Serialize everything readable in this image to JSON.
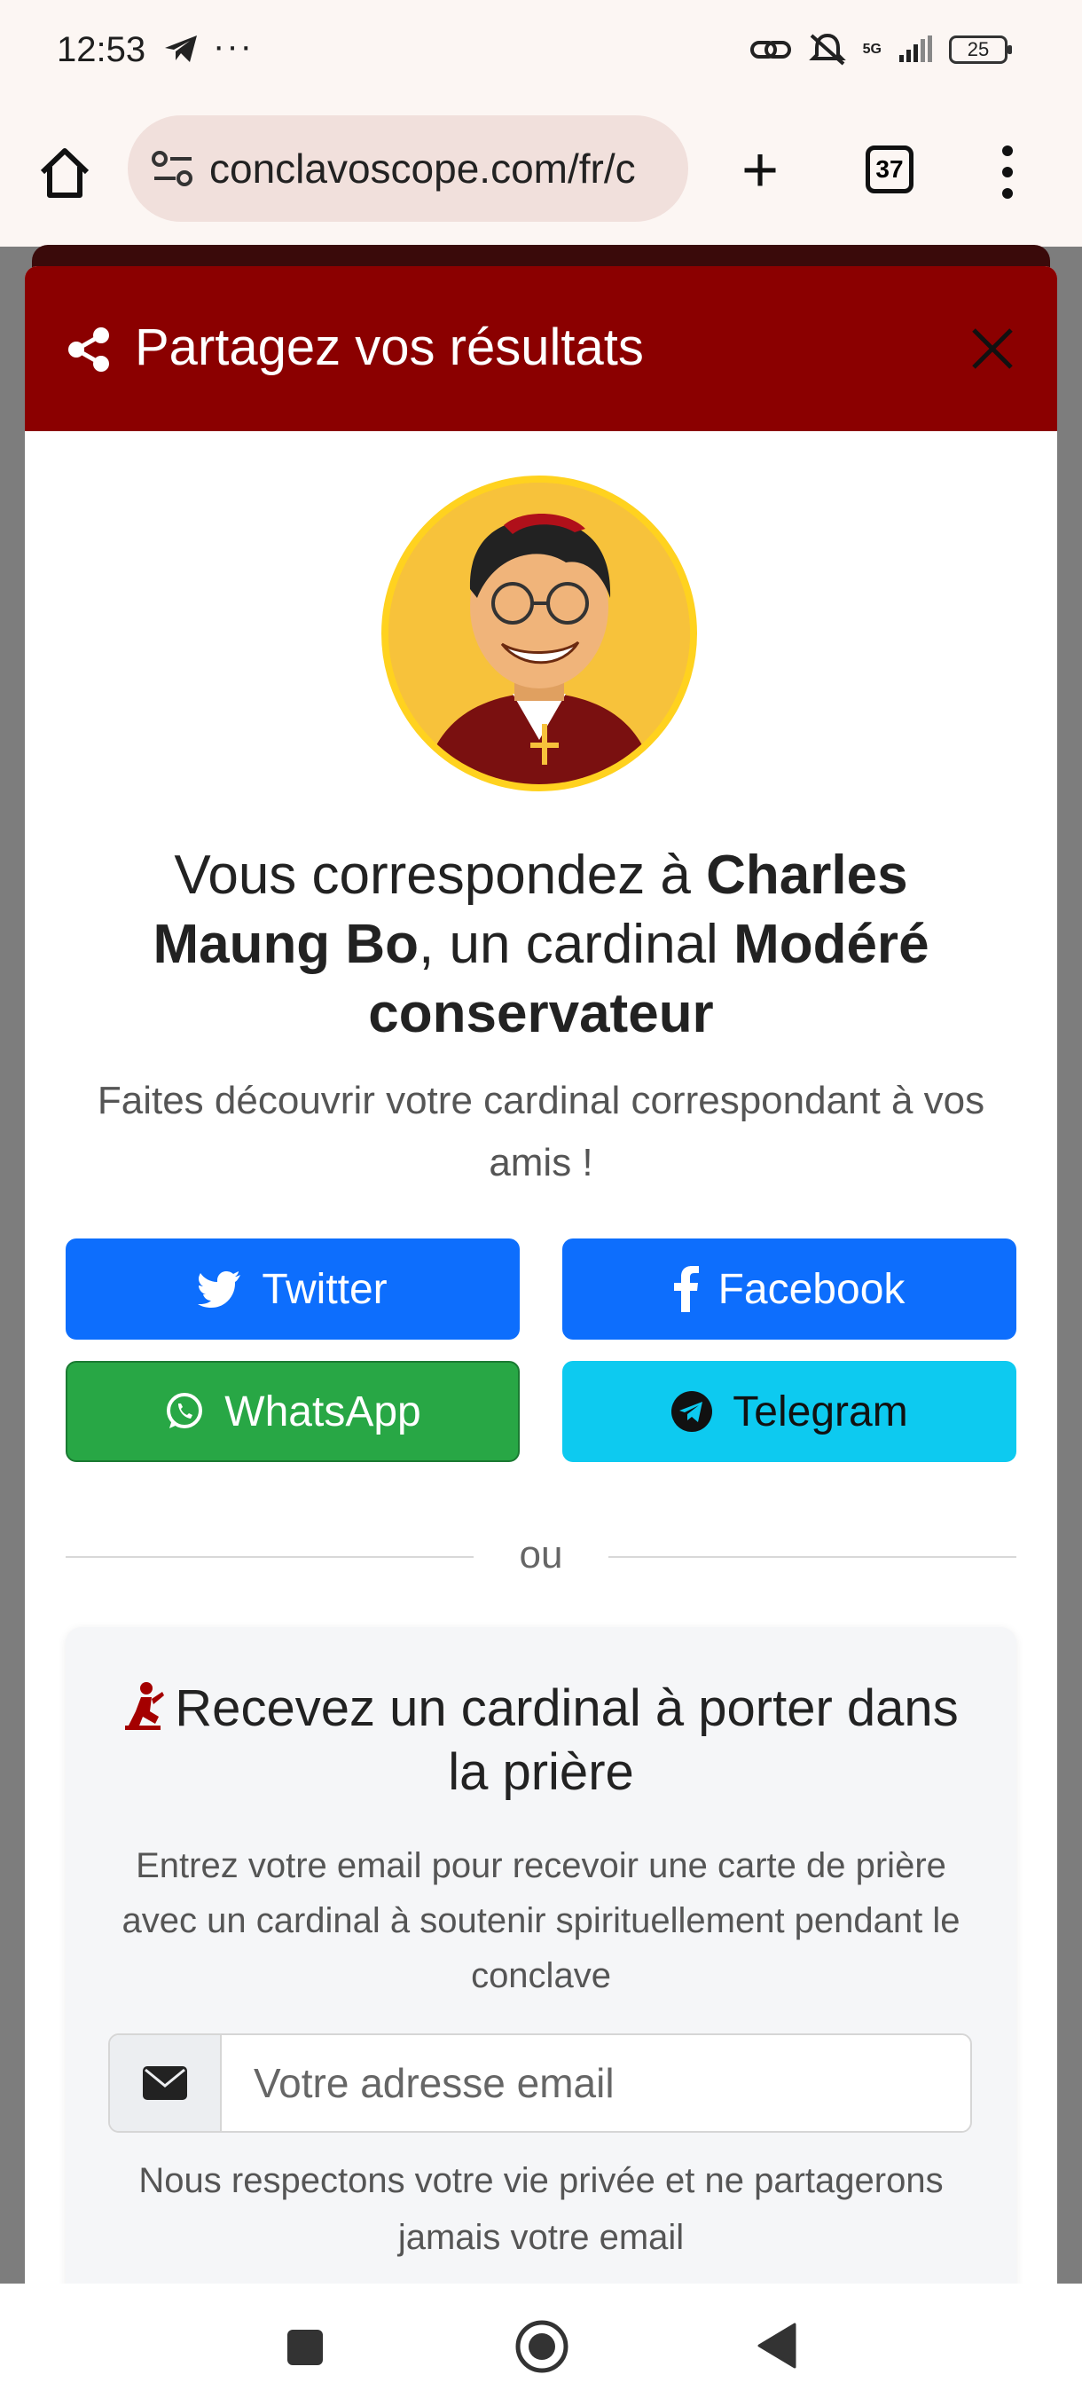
{
  "status_bar": {
    "time": "12:53",
    "overflow": "···",
    "network": "5G",
    "battery": "25"
  },
  "browser": {
    "url": "conclavoscope.com/fr/c",
    "tab_count": "37"
  },
  "modal": {
    "title": "Partagez vos résultats",
    "match_prefix": "Vous correspondez à ",
    "cardinal_name": "Charles Maung Bo",
    "match_middle": ", un cardinal ",
    "cardinal_type": "Modéré conservateur",
    "subtext": "Faites découvrir votre cardinal correspondant à vos amis !",
    "share_buttons": {
      "twitter": "Twitter",
      "facebook": "Facebook",
      "whatsapp": "WhatsApp",
      "telegram": "Telegram"
    },
    "or_label": "ou",
    "prayer": {
      "title": "Recevez un cardinal à porter dans la prière",
      "description": "Entrez votre email pour recevoir une carte de prière avec un cardinal à soutenir spirituellement pendant le conclave",
      "email_placeholder": "Votre adresse email",
      "privacy": "Nous respectons votre vie privée et ne partagerons jamais votre email"
    }
  },
  "colors": {
    "header": "#8b0000",
    "primary": "#0d6efd",
    "whatsapp": "#28a745",
    "telegram": "#0dcaf0",
    "avatar_bg": "#f7c23b"
  }
}
